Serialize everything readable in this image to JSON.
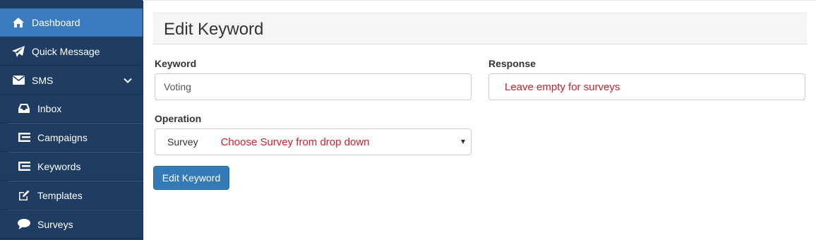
{
  "sidebar": {
    "items": [
      {
        "label": "Dashboard",
        "icon": "home-icon",
        "active": true
      },
      {
        "label": "Quick Message",
        "icon": "paper-plane-icon"
      },
      {
        "label": "SMS",
        "icon": "envelope-icon",
        "expanded": true
      },
      {
        "label": "Inbox",
        "icon": "inbox-icon"
      },
      {
        "label": "Campaigns",
        "icon": "list-icon"
      },
      {
        "label": "Keywords",
        "icon": "list-icon"
      },
      {
        "label": "Templates",
        "icon": "edit-icon"
      },
      {
        "label": "Surveys",
        "icon": "comment-icon"
      }
    ],
    "colors": {
      "background": "#1f3c62",
      "active": "#3b7bbf"
    }
  },
  "page": {
    "title": "Edit Keyword"
  },
  "form": {
    "keyword": {
      "label": "Keyword",
      "value": "Voting"
    },
    "response": {
      "label": "Response",
      "placeholder": "Leave empty for surveys"
    },
    "operation": {
      "label": "Operation",
      "selected": "Survey",
      "hint": "Choose Survey from drop down"
    },
    "submit_label": "Edit Keyword"
  },
  "colors": {
    "primary_button": "#337ab7",
    "annotation_red": "#d01f2b"
  }
}
